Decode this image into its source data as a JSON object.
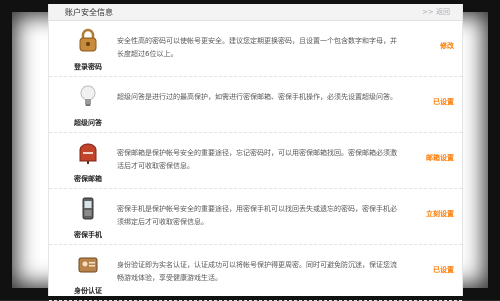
{
  "header": {
    "title": "账户安全信息",
    "back": ">> 返回"
  },
  "rows": [
    {
      "label": "登录密码",
      "icon": "padlock-icon",
      "desc": "安全性高的密码可以使帐号更安全。建议您定期更换密码，且设置一个包含数字和字母，并长度超过6位以上。",
      "action": "修改"
    },
    {
      "label": "超级问答",
      "icon": "lightbulb-icon",
      "desc": "超级问答是进行过的最高保护，如需进行密保邮箱、密保手机操作，必须先设置超级问答。",
      "action": "已设置"
    },
    {
      "label": "密保邮箱",
      "icon": "mailbox-icon",
      "desc": "密保邮箱是保护帐号安全的重要途径，忘记密码时，可以用密保邮箱找回。密保邮箱必须激活后才可收取密保信息。",
      "action": "邮箱设置"
    },
    {
      "label": "密保手机",
      "icon": "mobile-phone-icon",
      "desc": "密保手机是保护帐号安全的重要途径，用密保手机可以找回丢失或遗忘的密码，密保手机必须绑定后才可收取密保信息。",
      "action": "立刻设置"
    },
    {
      "label": "身份认证",
      "icon": "id-card-icon",
      "desc": "身份验证即为实名认证，认证成功可以将帐号保护得更周密。同时可避免防沉迷，保证您流畅游戏体验，享受健康游戏生活。",
      "action": "已设置"
    }
  ]
}
